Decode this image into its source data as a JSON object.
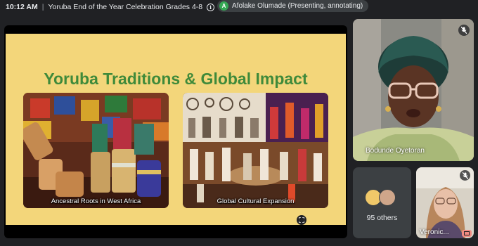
{
  "topbar": {
    "time": "10:12 AM",
    "separator": "|",
    "meeting_title": "Yoruba End of the Year Celebration Grades 4-8",
    "presenter_initial": "A",
    "presenter_status": "Afolake Olumade (Presenting, annotating)"
  },
  "slide": {
    "title": "Yoruba Traditions & Global Impact",
    "left_caption": "Ancestral Roots in West Africa",
    "right_caption": "Global Cultural Expansion"
  },
  "participants": {
    "main_name": "Bodunde Oyetoran",
    "others_label": "95 others",
    "small_name": "Veronic..."
  },
  "colors": {
    "slide_bg": "#f3d67a",
    "title_green": "#3f8a3a",
    "chip_green": "#34a853"
  },
  "icons": [
    "info-icon",
    "mic-off-icon",
    "expand-icon",
    "annotate-icon"
  ]
}
